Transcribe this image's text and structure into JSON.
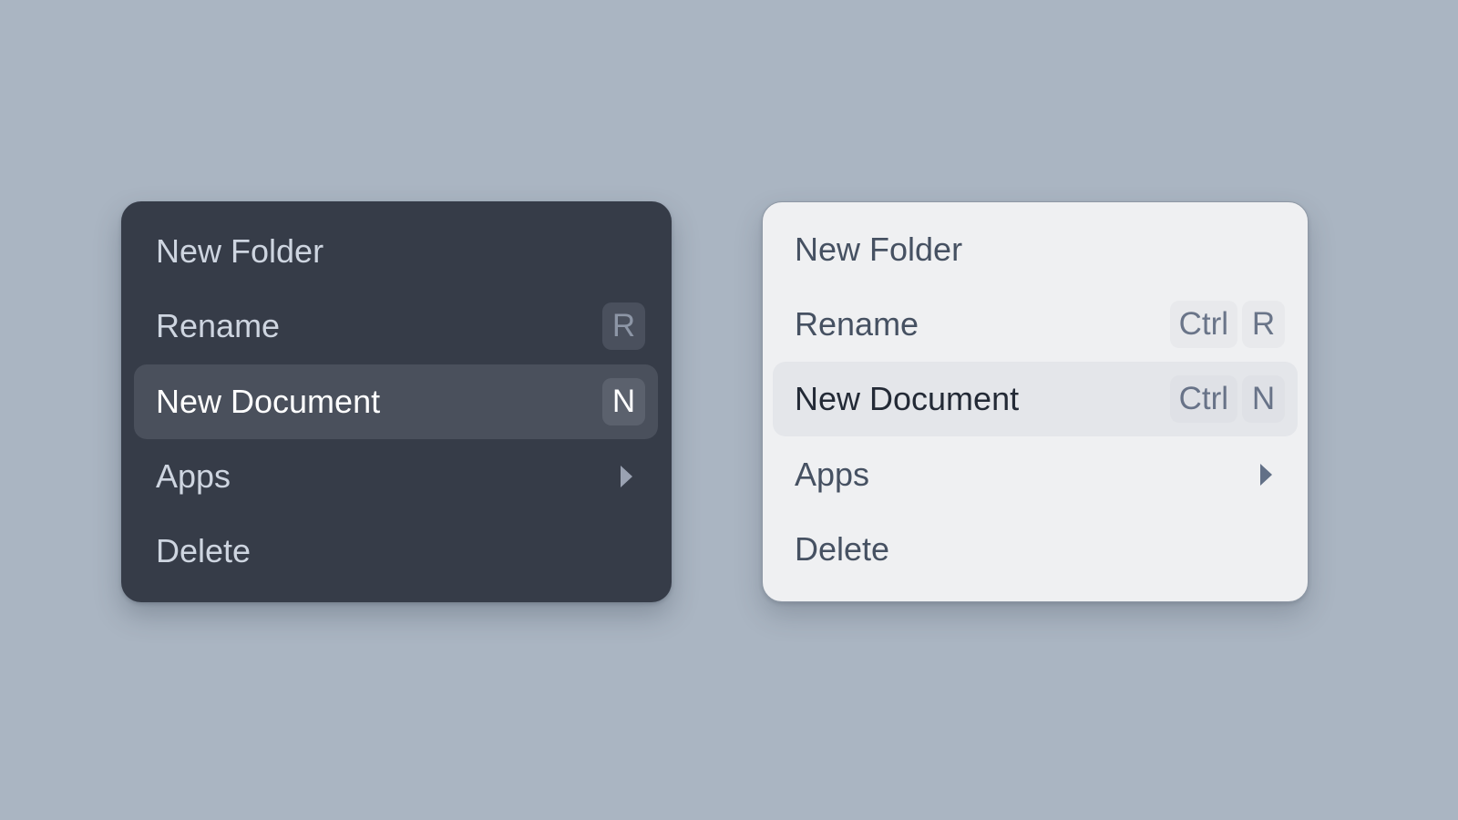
{
  "menus": [
    {
      "theme": "dark",
      "items": [
        {
          "label": "New Folder",
          "shortcut": [],
          "submenu": false,
          "highlighted": false
        },
        {
          "label": "Rename",
          "shortcut": [
            "R"
          ],
          "submenu": false,
          "highlighted": false
        },
        {
          "label": "New Document",
          "shortcut": [
            "N"
          ],
          "submenu": false,
          "highlighted": true
        },
        {
          "label": "Apps",
          "shortcut": [],
          "submenu": true,
          "submenu_icon": "chevron-right-icon",
          "highlighted": false
        },
        {
          "label": "Delete",
          "shortcut": [],
          "submenu": false,
          "highlighted": false
        }
      ]
    },
    {
      "theme": "light",
      "items": [
        {
          "label": "New Folder",
          "shortcut": [],
          "submenu": false,
          "highlighted": false
        },
        {
          "label": "Rename",
          "shortcut": [
            "Ctrl",
            "R"
          ],
          "submenu": false,
          "highlighted": false
        },
        {
          "label": "New Document",
          "shortcut": [
            "Ctrl",
            "N"
          ],
          "submenu": false,
          "highlighted": true
        },
        {
          "label": "Apps",
          "shortcut": [],
          "submenu": true,
          "submenu_icon": "chevron-right-icon",
          "highlighted": false
        },
        {
          "label": "Delete",
          "shortcut": [],
          "submenu": false,
          "highlighted": false
        }
      ]
    }
  ],
  "colors": {
    "background": "#aab5c2",
    "dark_menu_bg": "#363c48",
    "dark_highlight_bg": "#4a505c",
    "light_menu_bg": "#eff0f2",
    "light_highlight_bg": "#e4e6ea"
  }
}
